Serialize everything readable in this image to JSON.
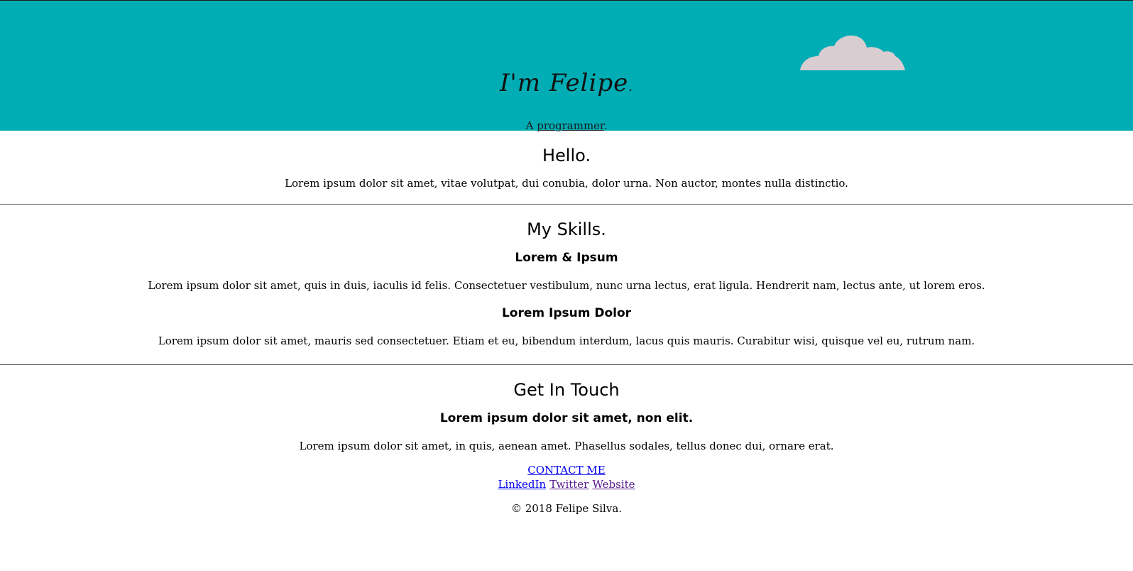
{
  "header": {
    "title": "I'm Felipe",
    "title_dot": ".",
    "subtitle_prefix": "A ",
    "subtitle_underlined": "programmer",
    "subtitle_suffix": ".",
    "background_color": "#00adb5",
    "cloud_icon": "cloud-icon"
  },
  "hello": {
    "heading": "Hello.",
    "text": "Lorem ipsum dolor sit amet, vitae volutpat, dui conubia, dolor urna. Non auctor, montes nulla distinctio."
  },
  "skills": {
    "heading": "My Skills.",
    "items": [
      {
        "title": "Lorem & Ipsum",
        "text": "Lorem ipsum dolor sit amet, quis in duis, iaculis id felis. Consectetuer vestibulum, nunc urna lectus, erat ligula. Hendrerit nam, lectus ante, ut lorem eros."
      },
      {
        "title": "Lorem Ipsum Dolor",
        "text": "Lorem ipsum dolor sit amet, mauris sed consectetuer. Etiam et eu, bibendum interdum, lacus quis mauris. Curabitur wisi, quisque vel eu, rutrum nam."
      }
    ]
  },
  "contact": {
    "heading": "Get In Touch",
    "subheading": "Lorem ipsum dolor sit amet, non elit.",
    "text": "Lorem ipsum dolor sit amet, in quis, aenean amet. Phasellus sodales, tellus donec dui, ornare erat.",
    "contact_label": "CONTACT ME",
    "links": {
      "linkedin": "LinkedIn",
      "twitter": "Twitter",
      "website": "Website"
    },
    "copyright": "© 2018 Felipe Silva."
  }
}
